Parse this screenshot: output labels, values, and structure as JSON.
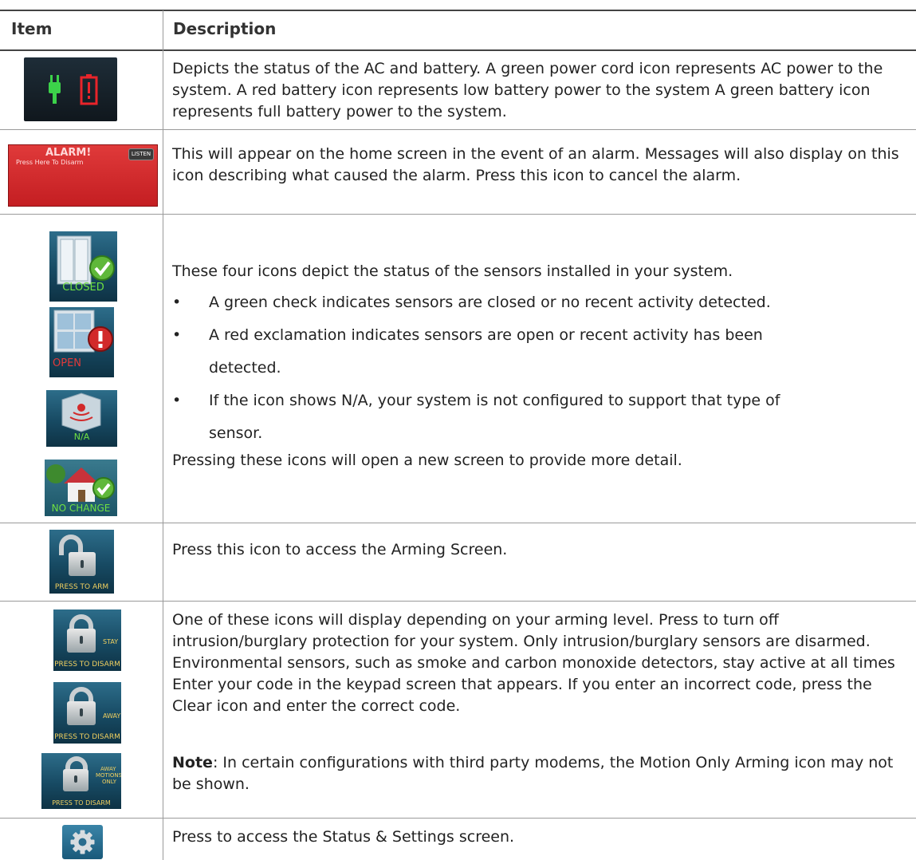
{
  "table": {
    "header_item": "Item",
    "header_description": "Description"
  },
  "icons": {
    "power_battery": {
      "plug_color": "#3cd24a",
      "battery_color": "#e8242a"
    },
    "alarm": {
      "title": "ALARM!",
      "subtitle": "Press Here To Disarm",
      "listen": "LISTEN"
    },
    "closed": {
      "caption": "CLOSED"
    },
    "open": {
      "caption": "OPEN"
    },
    "na": {
      "caption": "N/A"
    },
    "no_change": {
      "caption": "NO CHANGE"
    },
    "press_to_arm": {
      "caption": "PRESS TO ARM"
    },
    "stay": {
      "side": "STAY",
      "caption": "PRESS TO DISARM"
    },
    "away": {
      "side": "AWAY",
      "caption": "PRESS TO DISARM"
    },
    "away_motions": {
      "side1": "AWAY",
      "side2": "MOTIONS",
      "side3": "ONLY",
      "caption": "PRESS TO DISARM"
    }
  },
  "rows": {
    "r1": {
      "text": "Depicts the status of the AC and battery. A green power cord icon represents AC power to the system. A red battery icon represents low battery power to the system A green battery icon represents full battery power to the system."
    },
    "r2": {
      "text": "This will appear on the home screen in the event of an alarm. Messages will also display on this icon describing what caused the alarm. Press this icon to cancel the alarm."
    },
    "r3": {
      "intro": "These four icons depict the status of the sensors installed in your system.",
      "bullet": "•",
      "b1": "A green check indicates sensors are closed or no recent activity detected.",
      "b2a": "A red exclamation indicates sensors are open or recent activity has been",
      "b2b": "detected.",
      "b3a": "If the icon shows N/A, your system is not configured to support that type of",
      "b3b": "sensor.",
      "outro": "Pressing these icons will open a new screen to provide more detail."
    },
    "r4": {
      "text": "Press this icon to access the Arming Screen."
    },
    "r5": {
      "text": "One of these icons will display depending on your arming level. Press to turn off intrusion/burglary protection for your system. Only intrusion/burglary sensors are disarmed. Environmental sensors, such as smoke and carbon monoxide detectors, stay active at all times Enter your code in the keypad screen that appears. If you enter an incorrect code, press the Clear icon and enter the correct code.",
      "note_label": "Note",
      "note_text": ": In certain configurations with third party modems, the Motion Only Arming icon may not be shown."
    },
    "r6": {
      "text": "Press to access the Status & Settings screen."
    }
  }
}
